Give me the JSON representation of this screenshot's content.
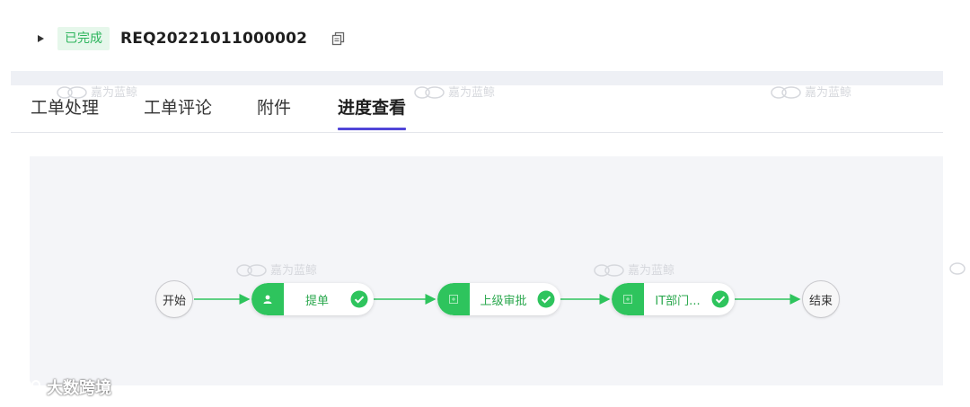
{
  "header": {
    "status": "已完成",
    "ticket_id": "REQ20221011000002"
  },
  "tabs": [
    {
      "label": "工单处理",
      "active": false
    },
    {
      "label": "工单评论",
      "active": false
    },
    {
      "label": "附件",
      "active": false
    },
    {
      "label": "进度查看",
      "active": true
    }
  ],
  "flow": {
    "start": "开始",
    "end": "结束",
    "steps": [
      {
        "label": "提单",
        "icon": "user-icon",
        "status": "completed"
      },
      {
        "label": "上级审批",
        "icon": "approval-icon",
        "status": "completed"
      },
      {
        "label": "IT部门...",
        "icon": "approval-icon",
        "status": "completed"
      }
    ]
  },
  "watermarks": {
    "light": "嘉为蓝鲸",
    "corner": "大数跨境"
  },
  "colors": {
    "accent": "#5146d8",
    "success": "#2ec45d",
    "success_text": "#2ba84e",
    "badge_bg": "#e6f7eb",
    "canvas_bg": "#f4f5f8"
  }
}
